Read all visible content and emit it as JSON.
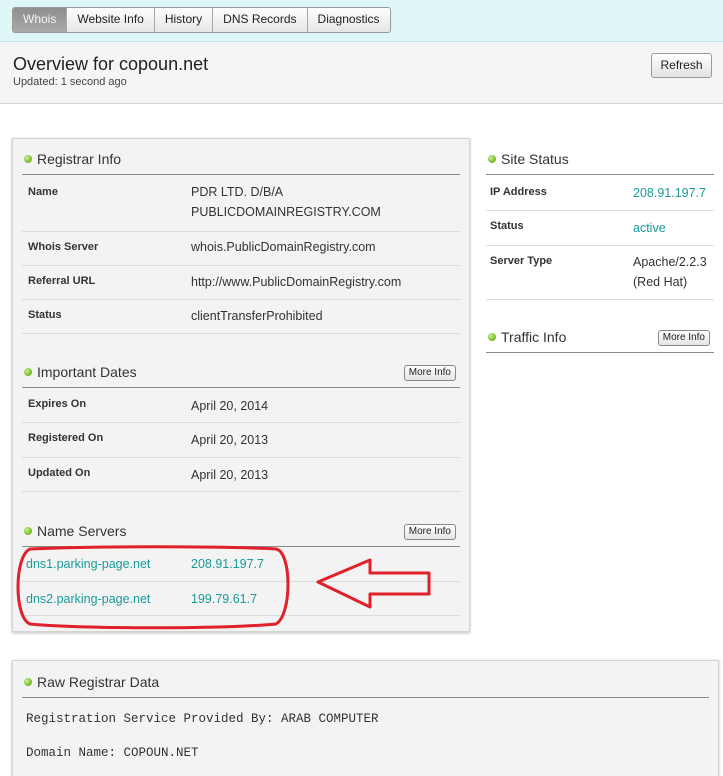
{
  "tabs": [
    {
      "label": "Whois",
      "active": true
    },
    {
      "label": "Website Info",
      "active": false
    },
    {
      "label": "History",
      "active": false
    },
    {
      "label": "DNS Records",
      "active": false
    },
    {
      "label": "Diagnostics",
      "active": false
    }
  ],
  "header": {
    "title": "Overview for copoun.net",
    "updated": "Updated: 1 second ago",
    "refresh_label": "Refresh"
  },
  "registrar_info": {
    "title": "Registrar Info",
    "rows": [
      {
        "label": "Name",
        "value_line1": "PDR LTD. D/B/A",
        "value_line2": "PUBLICDOMAINREGISTRY.COM"
      },
      {
        "label": "Whois Server",
        "value": "whois.PublicDomainRegistry.com"
      },
      {
        "label": "Referral URL",
        "value": "http://www.PublicDomainRegistry.com"
      },
      {
        "label": "Status",
        "value": "clientTransferProhibited"
      }
    ]
  },
  "important_dates": {
    "title": "Important Dates",
    "more_label": "More Info",
    "rows": [
      {
        "label": "Expires On",
        "value": "April 20, 2014"
      },
      {
        "label": "Registered On",
        "value": "April 20, 2013"
      },
      {
        "label": "Updated On",
        "value": "April 20, 2013"
      }
    ]
  },
  "name_servers": {
    "title": "Name Servers",
    "more_label": "More Info",
    "rows": [
      {
        "host": "dns1.parking-page.net",
        "ip": "208.91.197.7"
      },
      {
        "host": "dns2.parking-page.net",
        "ip": "199.79.61.7"
      }
    ]
  },
  "site_status": {
    "title": "Site Status",
    "rows": [
      {
        "label": "IP Address",
        "value": "208.91.197.7"
      },
      {
        "label": "Status",
        "value": "active"
      },
      {
        "label": "Server Type",
        "value_line1": "Apache/2.2.3",
        "value_line2": "(Red Hat)"
      }
    ]
  },
  "traffic_info": {
    "title": "Traffic Info",
    "more_label": "More Info"
  },
  "raw_registrar_data": {
    "title": "Raw Registrar Data",
    "lines": [
      "Registration Service Provided By: ARAB COMPUTER",
      "Domain Name: COPOUN.NET"
    ]
  },
  "colors": {
    "link": "#1a9a9a",
    "annotation": "#e0202a",
    "active_tab": "#9b9b9b",
    "topbar": "#dff6f6"
  },
  "icons": {
    "section_bullet": "green-dot-icon"
  }
}
